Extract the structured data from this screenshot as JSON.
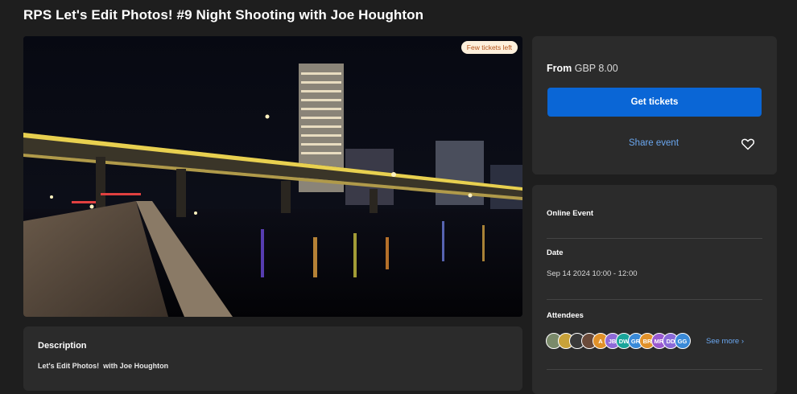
{
  "event": {
    "title": "RPS Let's Edit Photos! #9 Night Shooting with Joe Houghton",
    "badge": "Few tickets left"
  },
  "description": {
    "heading": "Description",
    "text": "Let's Edit Photos!  with Joe Houghton"
  },
  "tickets": {
    "from_label": "From",
    "price": "GBP 8.00",
    "button": "Get tickets",
    "share": "Share event",
    "favorite_icon": "heart-icon"
  },
  "info": {
    "type": "Online Event",
    "date_label": "Date",
    "date_value": "Sep 14 2024 10:00 - 12:00",
    "attendees_label": "Attendees",
    "see_more": "See more ›",
    "attendees": [
      {
        "initials": "",
        "color": "#7a8a6a"
      },
      {
        "initials": "",
        "color": "#c8a23a"
      },
      {
        "initials": "",
        "color": "#3a3a3a"
      },
      {
        "initials": "",
        "color": "#6a4a3a"
      },
      {
        "initials": "A",
        "color": "#e0912a"
      },
      {
        "initials": "JB",
        "color": "#8e6ad8"
      },
      {
        "initials": "DW",
        "color": "#1aa59a"
      },
      {
        "initials": "GR",
        "color": "#3a8ad8"
      },
      {
        "initials": "BR",
        "color": "#e0912a"
      },
      {
        "initials": "MR",
        "color": "#9a5ad0"
      },
      {
        "initials": "DD",
        "color": "#8a6ad8"
      },
      {
        "initials": "GG",
        "color": "#3a8ad8"
      }
    ]
  },
  "colors": {
    "accent": "#0a66d6",
    "link": "#6aa7f0",
    "card": "#2b2b2b",
    "background": "#1e1e1e"
  }
}
